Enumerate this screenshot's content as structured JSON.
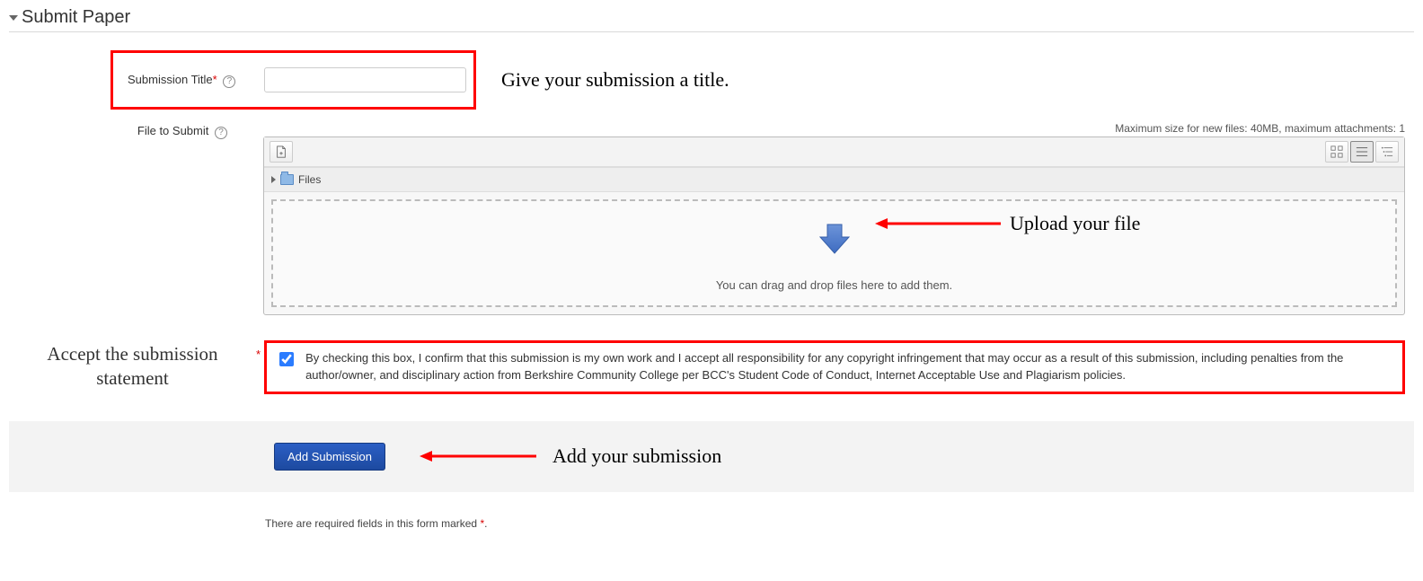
{
  "section": {
    "title": "Submit Paper"
  },
  "field_title": {
    "label": "Submission Title",
    "value": "",
    "placeholder": ""
  },
  "field_file": {
    "label": "File to Submit",
    "max_info": "Maximum size for new files: 40MB, maximum attachments: 1"
  },
  "filepicker": {
    "breadcrumb": "Files",
    "dropzone_text": "You can drag and drop files here to add them."
  },
  "statement": {
    "left_line1": "Accept the submission",
    "left_line2": "statement",
    "text": "By checking this box, I confirm that this submission is my own work and I accept all responsibility for any copyright infringement that may occur as a result of this submission, including penalties from the author/owner, and disciplinary action from Berkshire Community College per BCC's Student Code of Conduct, Internet Acceptable Use and Plagiarism policies.",
    "checked": true
  },
  "action": {
    "submit_label": "Add Submission"
  },
  "annotations": {
    "title": "Give your submission a title.",
    "upload": "Upload your file",
    "add": "Add your submission"
  },
  "footnote": {
    "text_before": "There are required fields in this form marked ",
    "text_after": "."
  }
}
